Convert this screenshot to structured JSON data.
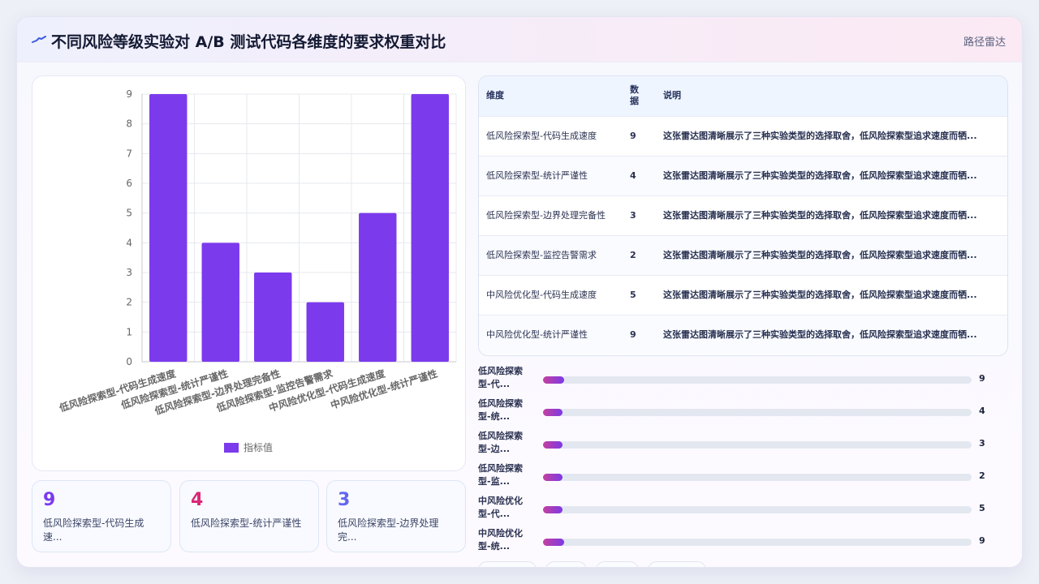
{
  "header": {
    "title": "不同风险等级实验对 A/B 测试代码各维度的要求权重对比",
    "tag": "路径雷达"
  },
  "colors": {
    "bar": "#7c3aed",
    "accent_pink": "#db2777",
    "accent_indigo": "#6366f1"
  },
  "chart_data": {
    "type": "bar",
    "categories": [
      "低风险探索型-代码生成速度",
      "低风险探索型-统计严谨性",
      "低风险探索型-边界处理完备性",
      "低风险探索型-监控告警需求",
      "中风险优化型-代码生成速度",
      "中风险优化型-统计严谨性"
    ],
    "series": [
      {
        "name": "指标值",
        "values": [
          9,
          4,
          3,
          2,
          5,
          9
        ]
      }
    ],
    "ylim": [
      0,
      9
    ],
    "yticks": [
      "0",
      "1",
      "2",
      "3",
      "4",
      "5",
      "6",
      "7",
      "8",
      "9"
    ],
    "legend": "bottom",
    "grid": true
  },
  "stats": [
    {
      "value": "9",
      "label": "低风险探索型-代码生成速..."
    },
    {
      "value": "4",
      "label": "低风险探索型-统计严谨性"
    },
    {
      "value": "3",
      "label": "低风险探索型-边界处理完..."
    }
  ],
  "table": {
    "headers": [
      "维度",
      "数据",
      "说明"
    ],
    "rows": [
      {
        "dim": "低风险探索型-代码生成速度",
        "val": "9",
        "note": "这张雷达图清晰展示了三种实验类型的选择取舍，低风险探索型追求速度而牺..."
      },
      {
        "dim": "低风险探索型-统计严谨性",
        "val": "4",
        "note": "这张雷达图清晰展示了三种实验类型的选择取舍，低风险探索型追求速度而牺..."
      },
      {
        "dim": "低风险探索型-边界处理完备性",
        "val": "3",
        "note": "这张雷达图清晰展示了三种实验类型的选择取舍，低风险探索型追求速度而牺..."
      },
      {
        "dim": "低风险探索型-监控告警需求",
        "val": "2",
        "note": "这张雷达图清晰展示了三种实验类型的选择取舍，低风险探索型追求速度而牺..."
      },
      {
        "dim": "中风险优化型-代码生成速度",
        "val": "5",
        "note": "这张雷达图清晰展示了三种实验类型的选择取舍，低风险探索型追求速度而牺..."
      },
      {
        "dim": "中风险优化型-统计严谨性",
        "val": "9",
        "note": "这张雷达图清晰展示了三种实验类型的选择取舍，低风险探索型追求速度而牺..."
      }
    ]
  },
  "progress": [
    {
      "label": "低风险探索型-代...",
      "value": "9",
      "fraction": 0.05
    },
    {
      "label": "低风险探索型-统...",
      "value": "4",
      "fraction": 0.045
    },
    {
      "label": "低风险探索型-边...",
      "value": "3",
      "fraction": 0.045
    },
    {
      "label": "低风险探索型-监...",
      "value": "2",
      "fraction": 0.045
    },
    {
      "label": "中风险优化型-代...",
      "value": "5",
      "fraction": 0.045
    },
    {
      "label": "中风险优化型-统...",
      "value": "9",
      "fraction": 0.05
    }
  ]
}
